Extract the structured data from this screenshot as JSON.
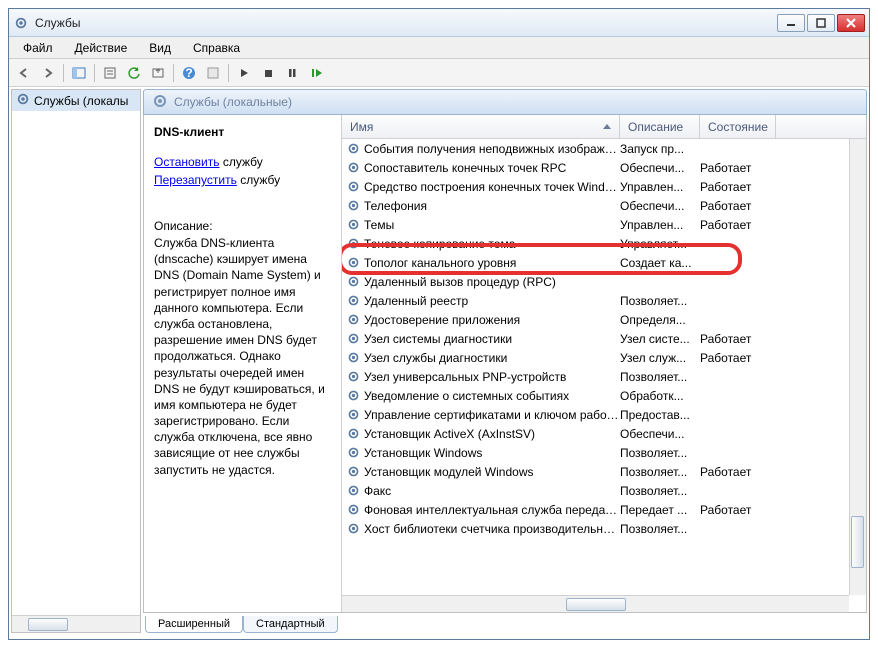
{
  "window": {
    "title": "Службы"
  },
  "menu": {
    "file": "Файл",
    "action": "Действие",
    "view": "Вид",
    "help": "Справка"
  },
  "tree": {
    "root": "Службы (локалы"
  },
  "main_header": "Службы (локальные)",
  "detail": {
    "name": "DNS-клиент",
    "stop_link": "Остановить",
    "stop_rest": " службу",
    "restart_link": "Перезапустить",
    "restart_rest": " службу",
    "desc_label": "Описание:",
    "desc_text": "Служба DNS-клиента (dnscache) кэширует имена DNS (Domain Name System) и регистрирует полное имя данного компьютера. Если служба остановлена, разрешение имен DNS будет продолжаться. Однако результаты очередей имен DNS не будут кэшироваться, и имя компьютера не будет зарегистрировано. Если служба отключена, все явно зависящие от нее службы запустить не удастся."
  },
  "columns": {
    "name": "Имя",
    "desc": "Описание",
    "state": "Состояние"
  },
  "services": [
    {
      "name": "События получения неподвижных изображений",
      "desc": "Запуск пр...",
      "state": ""
    },
    {
      "name": "Сопоставитель конечных точек RPC",
      "desc": "Обеспечи...",
      "state": "Работает"
    },
    {
      "name": "Средство построения конечных точек Windows ...",
      "desc": "Управлен...",
      "state": "Работает"
    },
    {
      "name": "Телефония",
      "desc": "Обеспечи...",
      "state": "Работает"
    },
    {
      "name": "Темы",
      "desc": "Управлен...",
      "state": "Работает"
    },
    {
      "name": "Теневое копирование тома",
      "desc": "Управляет...",
      "state": ""
    },
    {
      "name": "Тополог канального уровня",
      "desc": "Создает ка...",
      "state": ""
    },
    {
      "name": "Удаленный вызов процедур (RPC)",
      "desc": "",
      "state": ""
    },
    {
      "name": "Удаленный реестр",
      "desc": "Позволяет...",
      "state": ""
    },
    {
      "name": "Удостоверение приложения",
      "desc": "Определя...",
      "state": ""
    },
    {
      "name": "Узел системы диагностики",
      "desc": "Узел систе...",
      "state": "Работает"
    },
    {
      "name": "Узел службы диагностики",
      "desc": "Узел служ...",
      "state": "Работает"
    },
    {
      "name": "Узел универсальных PNP-устройств",
      "desc": "Позволяет...",
      "state": ""
    },
    {
      "name": "Уведомление о системных событиях",
      "desc": "Обработк...",
      "state": ""
    },
    {
      "name": "Управление сертификатами и ключом работос...",
      "desc": "Предостав...",
      "state": ""
    },
    {
      "name": "Установщик ActiveX (AxInstSV)",
      "desc": "Обеспечи...",
      "state": ""
    },
    {
      "name": "Установщик Windows",
      "desc": "Позволяет...",
      "state": ""
    },
    {
      "name": "Установщик модулей Windows",
      "desc": "Позволяет...",
      "state": "Работает"
    },
    {
      "name": "Факс",
      "desc": "Позволяет...",
      "state": ""
    },
    {
      "name": "Фоновая интеллектуальная служба передачи (BI...",
      "desc": "Передает ...",
      "state": "Работает"
    },
    {
      "name": "Хост библиотеки счетчика производительности",
      "desc": "Позволяет...",
      "state": ""
    }
  ],
  "tabs": {
    "extended": "Расширенный",
    "standard": "Стандартный"
  }
}
